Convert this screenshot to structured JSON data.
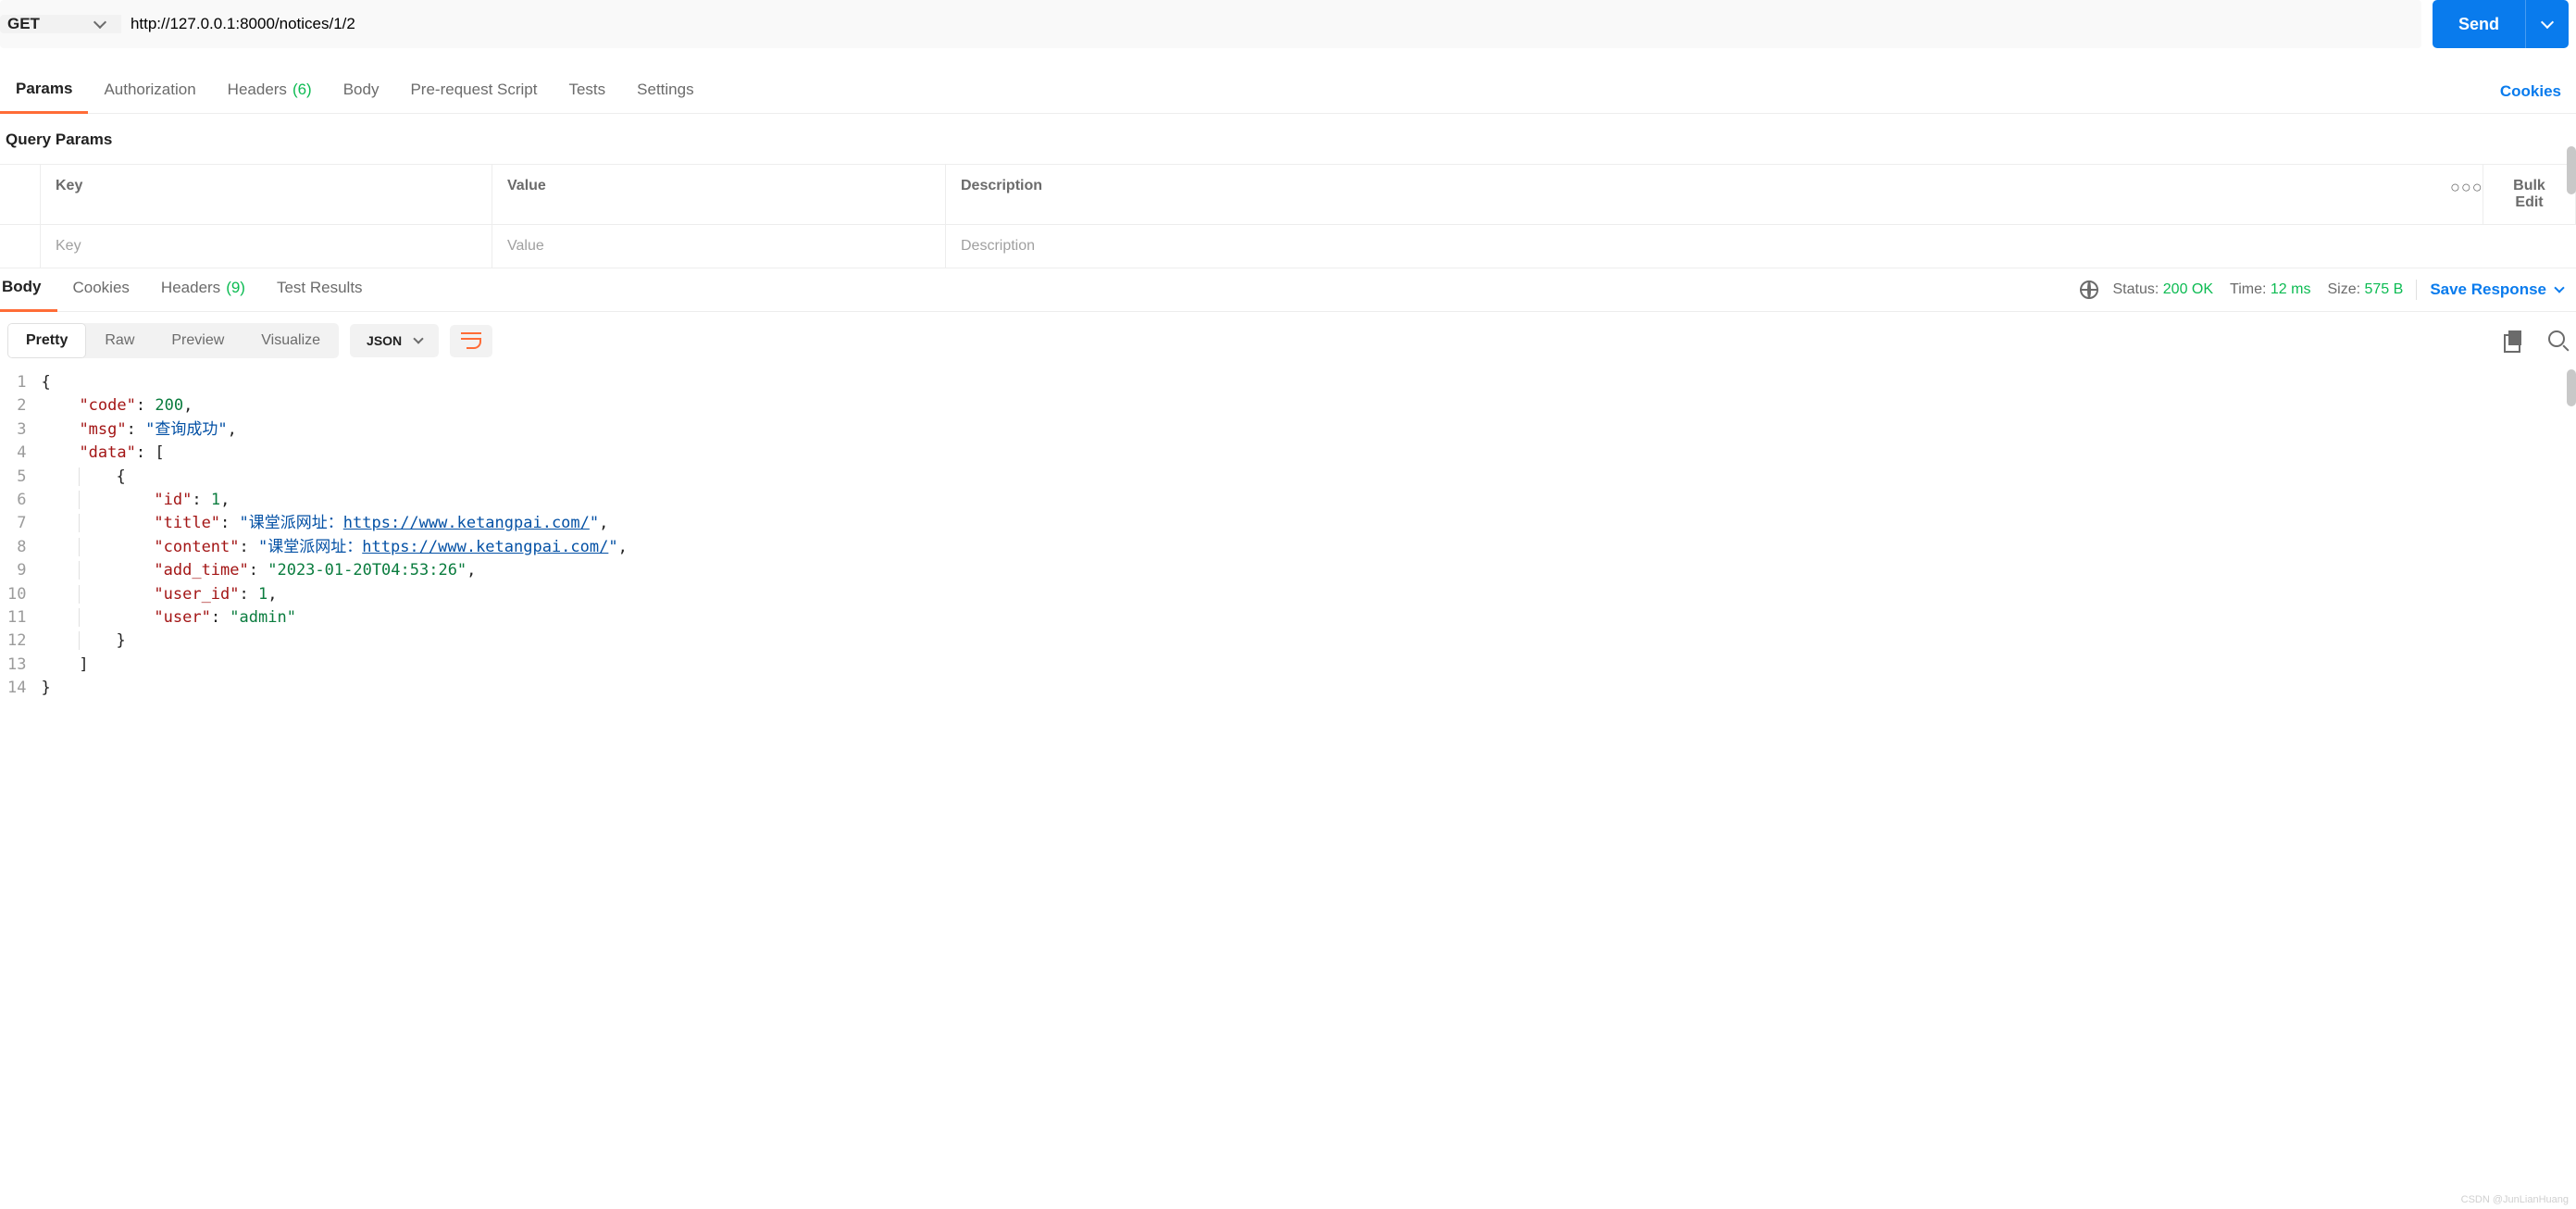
{
  "request": {
    "method": "GET",
    "url": "http://127.0.0.1:8000/notices/1/2",
    "send_label": "Send"
  },
  "req_tabs": {
    "params": "Params",
    "auth": "Authorization",
    "headers": "Headers",
    "headers_count": "(6)",
    "body": "Body",
    "prereq": "Pre-request Script",
    "tests": "Tests",
    "settings": "Settings",
    "cookies": "Cookies"
  },
  "params_section": {
    "title": "Query Params",
    "head_key": "Key",
    "head_value": "Value",
    "head_desc": "Description",
    "bulk_edit": "Bulk Edit",
    "ph_key": "Key",
    "ph_value": "Value",
    "ph_desc": "Description"
  },
  "resp_tabs": {
    "body": "Body",
    "cookies": "Cookies",
    "headers": "Headers",
    "headers_count": "(9)",
    "tests": "Test Results"
  },
  "resp_meta": {
    "status_label": "Status:",
    "status_value": "200 OK",
    "time_label": "Time:",
    "time_value": "12 ms",
    "size_label": "Size:",
    "size_value": "575 B",
    "save": "Save Response"
  },
  "view": {
    "pretty": "Pretty",
    "raw": "Raw",
    "preview": "Preview",
    "visualize": "Visualize",
    "format": "JSON"
  },
  "json_body": {
    "k_code": "\"code\"",
    "v_code": "200",
    "k_msg": "\"msg\"",
    "v_msg": "\"查询成功\"",
    "k_data": "\"data\"",
    "k_id": "\"id\"",
    "v_id": "1",
    "k_title": "\"title\"",
    "v_title_pre": "\"课堂派网址：",
    "v_title_url": "https://www.ketangpai.com/",
    "v_title_post": "\"",
    "k_content": "\"content\"",
    "v_content_pre": "\"课堂派网址：",
    "v_content_url": "https://www.ketangpai.com/",
    "v_content_post": "\"",
    "k_add": "\"add_time\"",
    "v_add": "\"2023-01-20T04:53:26\"",
    "k_uid": "\"user_id\"",
    "v_uid": "1",
    "k_user": "\"user\"",
    "v_user": "\"admin\""
  },
  "watermark": "CSDN @JunLianHuang"
}
